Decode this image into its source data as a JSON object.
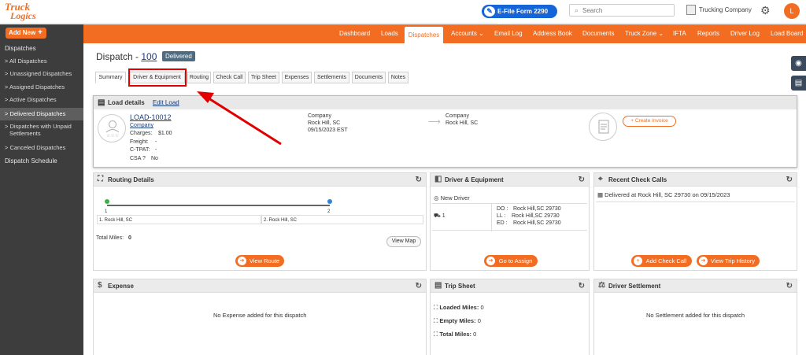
{
  "brand": {
    "line1": "Truck",
    "line2": "Logics"
  },
  "topbar": {
    "efile_label": "E-File Form 2290 Now",
    "search_placeholder": "Search",
    "company_name": "Trucking Company",
    "avatar_letter": "L"
  },
  "sidebar": {
    "add_new": "Add New",
    "section_title": "Dispatches",
    "items": [
      {
        "label": "> All Dispatches"
      },
      {
        "label": "> Unassigned Dispatches"
      },
      {
        "label": "> Assigned Dispatches"
      },
      {
        "label": "> Active Dispatches"
      },
      {
        "label": "> Delivered Dispatches",
        "active": true
      },
      {
        "label": "> Dispatches with Unpaid",
        "label2": "Settlements"
      },
      {
        "label": "> Canceled Dispatches"
      }
    ],
    "schedule": "Dispatch Schedule"
  },
  "nav": [
    "Dashboard",
    "Loads",
    "Dispatches",
    "Accounts ⌄",
    "Email Log",
    "Address Book",
    "Documents",
    "Truck Zone ⌄",
    "IFTA",
    "Reports",
    "Driver Log",
    "Load Board"
  ],
  "page": {
    "title_prefix": "Dispatch - ",
    "dispatch_number": "100",
    "status": "Delivered"
  },
  "tabs": [
    "Summary",
    "Driver & Equipment",
    "Routing",
    "Check Call",
    "Trip Sheet",
    "Expenses",
    "Settlements",
    "Documents",
    "Notes"
  ],
  "load": {
    "header": "Load details",
    "edit_link": "Edit Load",
    "load_id": "LOAD-10012",
    "company_link": "Company",
    "charges_label": "Charges:",
    "charges_value": "$1.00",
    "freight_label": "Freight:",
    "freight_value": "-",
    "ctpat_label": "C-TPAT:",
    "ctpat_value": "-",
    "csa_label": "CSA ?",
    "csa_value": "No",
    "origin": {
      "name": "Company",
      "city": "Rock Hill, SC",
      "date": "09/15/2023 EST"
    },
    "dest": {
      "name": "Company",
      "city": "Rock Hill, SC"
    },
    "create_invoice": "+ Create Invoice"
  },
  "routing": {
    "title": "Routing Details",
    "stop1": "1. Rock Hill, SC",
    "stop2": "2. Rock Hill, SC",
    "marker1": "1",
    "marker2": "2",
    "total_label": "Total Miles:",
    "total_value": "0",
    "view_map": "View Map",
    "view_route": "View Route"
  },
  "driver": {
    "title": "Driver & Equipment",
    "new_driver": "New Driver",
    "truck_num": "1",
    "do_label": "DO :",
    "do_value": "Rock Hill,SC 29730",
    "ll_label": "LL :",
    "ll_value": "Rock Hill,SC 29730",
    "ed_label": "ED :",
    "ed_value": "Rock Hill,SC 29730",
    "go_assign": "Go to Assign"
  },
  "checkcalls": {
    "title": "Recent Check Calls",
    "entry": "Delivered at Rock Hill, SC 29730 on 09/15/2023",
    "add": "Add Check Call",
    "history": "View Trip History"
  },
  "expense": {
    "title": "Expense",
    "empty": "No Expense added for this dispatch"
  },
  "tripsheet": {
    "title": "Trip Sheet",
    "loaded_label": "Loaded Miles:",
    "loaded_value": "0",
    "empty_label": "Empty Miles:",
    "empty_value": "0",
    "total_label": "Total Miles:",
    "total_value": "0"
  },
  "settlement": {
    "title": "Driver Settlement",
    "empty": "No Settlement added for this dispatch"
  },
  "colors": {
    "accent": "#f26d22",
    "highlight": "#e00000",
    "efile": "#1565d8",
    "sidebar": "#3d3d3d"
  }
}
